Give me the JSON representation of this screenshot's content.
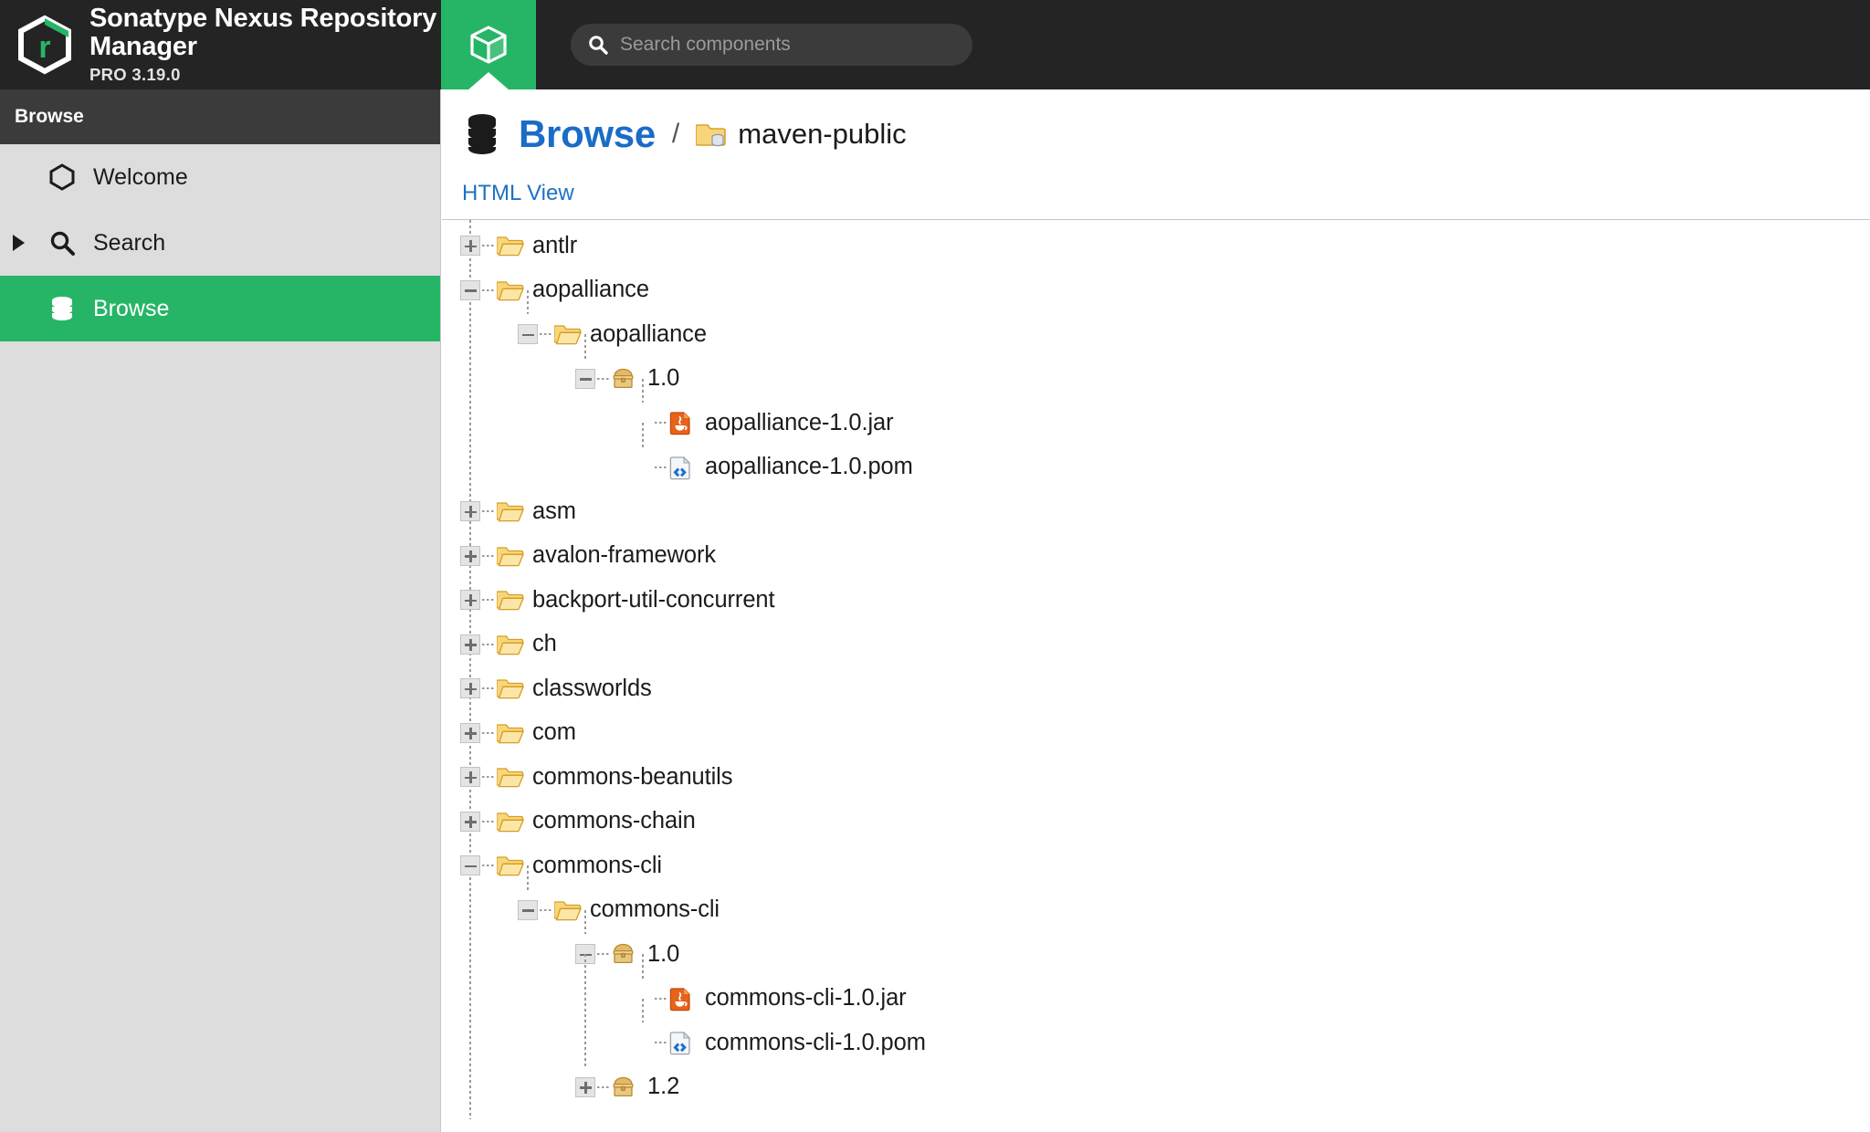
{
  "app": {
    "title": "Sonatype Nexus Repository Manager",
    "edition_version": "PRO 3.19.0",
    "logo_icon": "nexus-hexagon-logo"
  },
  "topbar": {
    "active_tab": {
      "icon": "cube-icon",
      "name": "browse-tab"
    },
    "search": {
      "icon": "search-icon",
      "placeholder": "Search components",
      "value": ""
    }
  },
  "sidebar": {
    "header": "Browse",
    "items": [
      {
        "label": "Welcome",
        "icon": "hexagon-icon",
        "selected": false,
        "expandable": false
      },
      {
        "label": "Search",
        "icon": "search-icon",
        "selected": false,
        "expandable": true
      },
      {
        "label": "Browse",
        "icon": "database-stack-icon",
        "selected": true,
        "expandable": false
      }
    ]
  },
  "main": {
    "breadcrumb": {
      "icon": "database-stack-icon",
      "root": "Browse",
      "separator": "/",
      "repo_icon": "repository-folder-icon",
      "repository": "maven-public"
    },
    "view_link": "HTML View"
  },
  "tree": {
    "nodes": [
      {
        "label": "antlr",
        "depth": 0,
        "toggle": "plus",
        "icon": "folder-open-icon"
      },
      {
        "label": "aopalliance",
        "depth": 0,
        "toggle": "minus",
        "icon": "folder-open-icon"
      },
      {
        "label": "aopalliance",
        "depth": 1,
        "toggle": "minus",
        "icon": "folder-open-icon"
      },
      {
        "label": "1.0",
        "depth": 2,
        "toggle": "minus",
        "icon": "package-chest-icon"
      },
      {
        "label": "aopalliance-1.0.jar",
        "depth": 3,
        "toggle": "none",
        "icon": "jar-file-icon"
      },
      {
        "label": "aopalliance-1.0.pom",
        "depth": 3,
        "toggle": "none",
        "icon": "pom-file-icon"
      },
      {
        "label": "asm",
        "depth": 0,
        "toggle": "plus",
        "icon": "folder-open-icon"
      },
      {
        "label": "avalon-framework",
        "depth": 0,
        "toggle": "plus",
        "icon": "folder-open-icon"
      },
      {
        "label": "backport-util-concurrent",
        "depth": 0,
        "toggle": "plus",
        "icon": "folder-open-icon"
      },
      {
        "label": "ch",
        "depth": 0,
        "toggle": "plus",
        "icon": "folder-open-icon"
      },
      {
        "label": "classworlds",
        "depth": 0,
        "toggle": "plus",
        "icon": "folder-open-icon"
      },
      {
        "label": "com",
        "depth": 0,
        "toggle": "plus",
        "icon": "folder-open-icon"
      },
      {
        "label": "commons-beanutils",
        "depth": 0,
        "toggle": "plus",
        "icon": "folder-open-icon"
      },
      {
        "label": "commons-chain",
        "depth": 0,
        "toggle": "plus",
        "icon": "folder-open-icon"
      },
      {
        "label": "commons-cli",
        "depth": 0,
        "toggle": "minus",
        "icon": "folder-open-icon"
      },
      {
        "label": "commons-cli",
        "depth": 1,
        "toggle": "minus",
        "icon": "folder-open-icon"
      },
      {
        "label": "1.0",
        "depth": 2,
        "toggle": "minus",
        "icon": "package-chest-icon"
      },
      {
        "label": "commons-cli-1.0.jar",
        "depth": 3,
        "toggle": "none",
        "icon": "jar-file-icon"
      },
      {
        "label": "commons-cli-1.0.pom",
        "depth": 3,
        "toggle": "none",
        "icon": "pom-file-icon"
      },
      {
        "label": "1.2",
        "depth": 2,
        "toggle": "plus",
        "icon": "package-chest-icon"
      }
    ]
  },
  "colors": {
    "brand_green": "#26b567",
    "topbar_dark": "#242424",
    "sidebar_gray": "#dddddd",
    "link_blue": "#1d72c4",
    "crumb_blue": "#1a6cc7",
    "folder_yellow": "#f5c243",
    "jar_orange": "#e8621a",
    "pom_blue": "#1f6fd0"
  }
}
